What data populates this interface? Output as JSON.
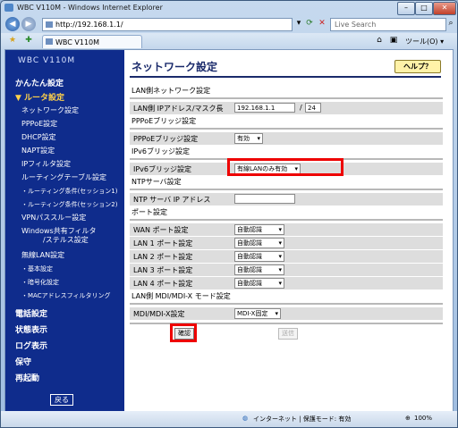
{
  "window": {
    "title": "WBC V110M - Windows Internet Explorer"
  },
  "address": {
    "url": "http://192.168.1.1/",
    "search_placeholder": "Live Search"
  },
  "tab": {
    "label": "WBC V110M"
  },
  "toolbar": {
    "tools_label": "ツール(O) ▾"
  },
  "sidebar": {
    "logo": "WBC V110M",
    "items": [
      "かんたん設定",
      "▼ ルータ設定",
      "ネットワーク設定",
      "PPPoE設定",
      "DHCP設定",
      "NAPT設定",
      "IPフィルタ設定",
      "ルーティングテーブル設定",
      "・ルーティング条件(セッション1)",
      "・ルーティング条件(セッション2)",
      "VPNパススルー設定",
      "Windows共有フィルタ",
      "/ステルス設定",
      "無線LAN設定",
      "・基本設定",
      "・暗号化設定",
      "・MACアドレスフィルタリング",
      "電話設定",
      "状態表示",
      "ログ表示",
      "保守",
      "再起動"
    ],
    "back_label": "戻る"
  },
  "main": {
    "title": "ネットワーク設定",
    "help_label": "ヘルプ？",
    "lan_section": "LAN側ネットワーク設定",
    "lan_ip_label": "LAN側 IPアドレス/マスク長",
    "lan_ip_value": "192.168.1.1",
    "slash": "/",
    "lan_mask_value": "24",
    "pppoe_bridge_section": "PPPoEブリッジ設定",
    "pppoe_bridge_label": "PPPoEブリッジ設定",
    "pppoe_bridge_value": "有効",
    "ipv6_bridge_section": "IPv6ブリッジ設定",
    "ipv6_bridge_label": "IPv6ブリッジ設定",
    "ipv6_bridge_value": "有線LANのみ有効",
    "ntp_section": "NTPサーバ設定",
    "ntp_label": "NTP サーバ IP アドレス",
    "ntp_value": "",
    "port_section": "ポート設定",
    "ports": [
      {
        "label": "WAN ポート設定",
        "value": "自動認識"
      },
      {
        "label": "LAN 1 ポート設定",
        "value": "自動認識"
      },
      {
        "label": "LAN 2 ポート設定",
        "value": "自動認識"
      },
      {
        "label": "LAN 3 ポート設定",
        "value": "自動認識"
      },
      {
        "label": "LAN 4 ポート設定",
        "value": "自動認識"
      }
    ],
    "mdi_section": "LAN側 MDI/MDI-X モード設定",
    "mdi_label": "MDI/MDI-X設定",
    "mdi_value": "MDI-X固定",
    "confirm_label": "確認",
    "send_label": "送信"
  },
  "statusbar": {
    "zone": "インターネット | 保護モード: 有効",
    "zoom": "100%"
  },
  "colors": {
    "sidebar_bg": "#0f2c8c",
    "highlight": "#e00000",
    "help_bg": "#fff2a8"
  }
}
